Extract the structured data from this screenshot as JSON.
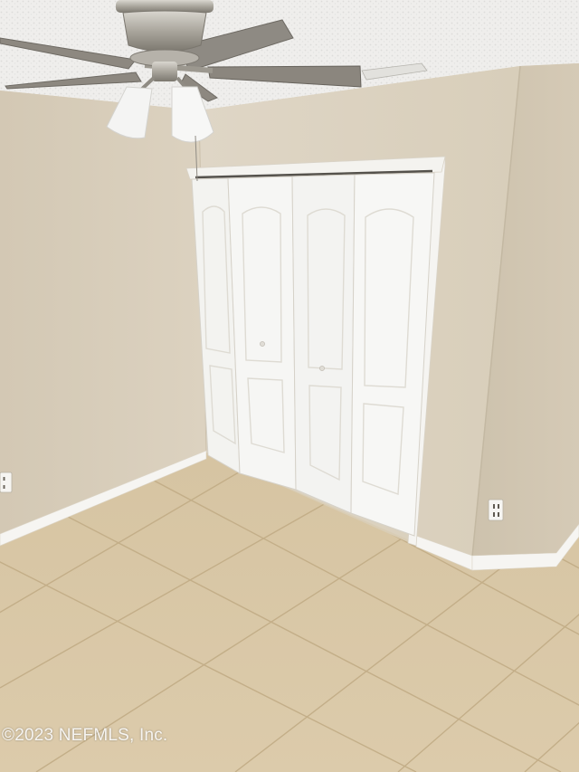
{
  "photo": {
    "subject": "Empty bedroom with bi-fold closet doors, ceiling fan and tile floor",
    "watermark": "©2023 NEFMLS, Inc.",
    "colors": {
      "wall": "#d6ccba",
      "wall_shadow": "#c9bfab",
      "ceiling": "#eeeeec",
      "floor": "#d8c6a3",
      "grout": "#c4b08a",
      "door": "#f4f4f1",
      "trim": "#f6f5f2"
    },
    "fixtures": {
      "ceiling_fan_icon": "ceiling-fan-icon",
      "outlet_icon": "electrical-outlet-icon"
    }
  }
}
